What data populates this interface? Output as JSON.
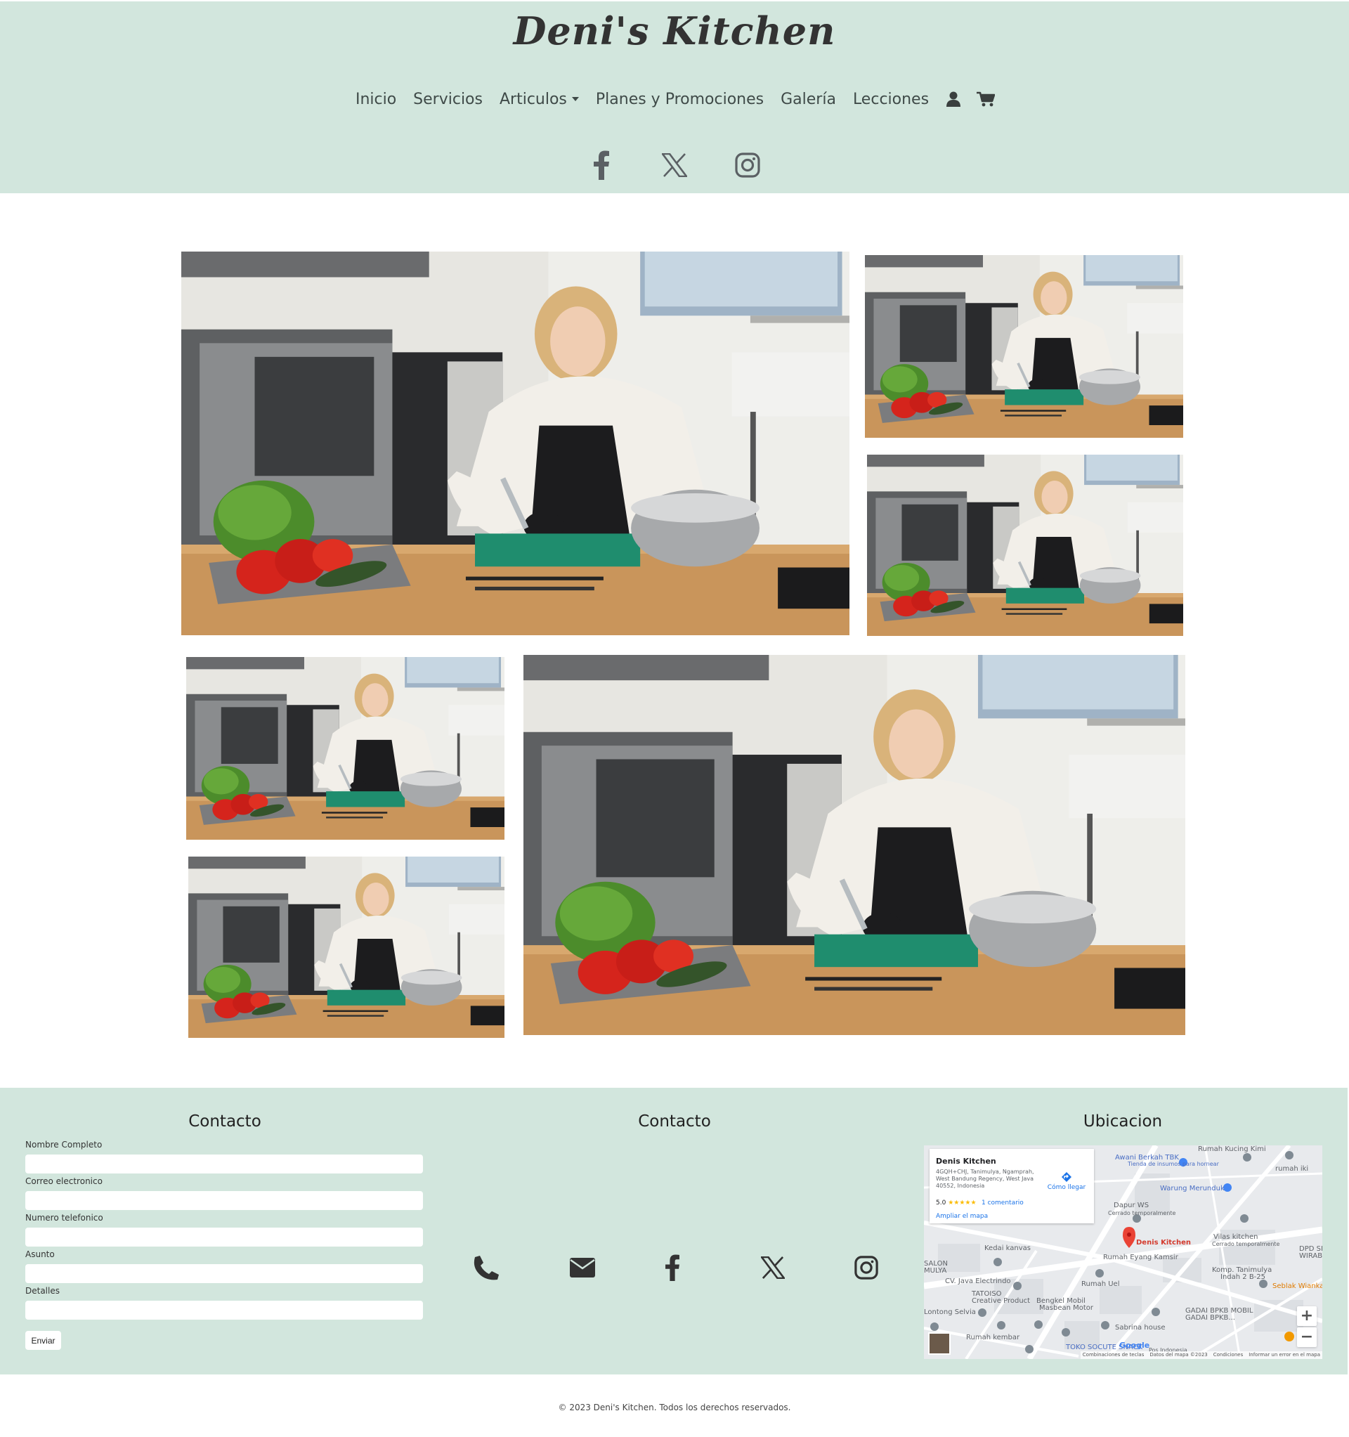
{
  "site": {
    "title": "Deni's Kitchen"
  },
  "nav": {
    "items": [
      {
        "label": "Inicio"
      },
      {
        "label": "Servicios"
      },
      {
        "label": "Articulos"
      },
      {
        "label": "Planes y Promociones"
      },
      {
        "label": "Galería"
      },
      {
        "label": "Lecciones"
      }
    ],
    "icons": [
      "user-icon",
      "cart-icon"
    ]
  },
  "header_social": [
    "facebook-icon",
    "x-icon",
    "instagram-icon"
  ],
  "gallery": {
    "image_description": "Chef cutting vegetables in a kitchen",
    "count": 6
  },
  "footer": {
    "form": {
      "title": "Contacto",
      "fields": [
        {
          "label": "Nombre Completo"
        },
        {
          "label": "Correo electronico"
        },
        {
          "label": "Numero telefonico"
        },
        {
          "label": "Asunto"
        },
        {
          "label": "Detalles"
        }
      ],
      "submit_label": "Enviar"
    },
    "contact": {
      "title": "Contacto",
      "icons": [
        "phone-icon",
        "envelope-icon",
        "facebook-icon",
        "x-icon",
        "instagram-icon"
      ]
    },
    "location": {
      "title": "Ubicacion",
      "map": {
        "place_name": "Denis Kitchen",
        "address": "4GQH+CHJ, Tanimulya, Ngamprah, West Bandung Regency, West Java 40552, Indonesia",
        "rating": "5.0",
        "stars": "★★★★★",
        "reviews": "1 comentario",
        "enlarge": "Ampliar el mapa",
        "directions": "Cómo llegar",
        "pin_label": "Denis Kitchen",
        "labels": {
          "awani": "Awani Berkah TBK",
          "awani_sub": "Tienda de insumos para hornear",
          "rumah_kucing": "Rumah Kucing Kimi",
          "rumah_iki": "rumah iki",
          "warung": "Warung Merunduk",
          "dapur": "Dapur WS",
          "dapur_sub": "Cerrado temporalmente",
          "vilas": "Vilas kitchen",
          "vilas_sub": "Cerrado temporalmente",
          "kedai": "Kedai kanvas",
          "salon": "SALON",
          "mulya": "MULYA",
          "java": "CV. Java Electrindo",
          "rumah_eyang": "Rumah Eyang Kamsir",
          "komp": "Komp. Tanimulya",
          "komp2": "Indah 2 B-25",
          "dpd": "DPD SI",
          "wirab": "WIRAB",
          "rumah_uel": "Rumah Uel",
          "tatoiso": "TATOISO",
          "creative": "Creative Product",
          "bengkel": "Bengkel Mobil",
          "masbean": "Masbean Motor",
          "seblak": "Seblak Wianka",
          "lontong": "Lontong Selvia",
          "gadai": "GADAI BPKB MOBIL",
          "gadai2": "GADAI BPKB...",
          "sabrina": "Sabrina house",
          "rumah_kembar": "Rumah kembar",
          "toko": "TOKO SOCUTE SNACK",
          "pos": "Pos Indonesia"
        },
        "attribution": [
          "Combinaciones de teclas",
          "Datos del mapa ©2023",
          "Condiciones",
          "Informar un error en el mapa"
        ],
        "logo": "Google",
        "zoom_in": "+",
        "zoom_out": "−"
      }
    }
  },
  "copyright": "© 2023 Deni's Kitchen. Todos los derechos reservados."
}
